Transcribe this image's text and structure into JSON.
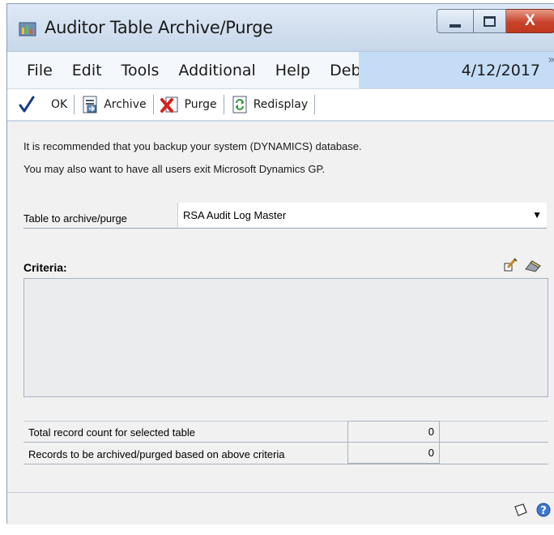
{
  "window": {
    "title": "Auditor Table Archive/Purge",
    "close_label": "X"
  },
  "menu": {
    "items": [
      "File",
      "Edit",
      "Tools",
      "Additional",
      "Help",
      "Debug"
    ],
    "date": "4/12/2017",
    "overflow": "»"
  },
  "toolbar": {
    "ok_label": "OK",
    "archive_label": "Archive",
    "purge_label": "Purge",
    "redisplay_label": "Redisplay"
  },
  "notes": {
    "line1": "It is recommended that you backup your system (DYNAMICS) database.",
    "line2": "You may also want to have all users exit Microsoft Dynamics GP."
  },
  "table_select": {
    "label": "Table to archive/purge",
    "value": "RSA Audit Log Master"
  },
  "criteria": {
    "label": "Criteria:"
  },
  "counts": [
    {
      "label": "Total record count for selected table",
      "value": "0"
    },
    {
      "label": "Records to be archived/purged based on above criteria",
      "value": "0"
    }
  ],
  "colors": {
    "accent": "#c5dcf7",
    "close_button": "#c9432c",
    "checkmark": "#1b3a8a"
  },
  "icons": [
    "app-icon",
    "checkmark-icon",
    "archive-icon",
    "purge-icon",
    "redisplay-icon",
    "edit-criteria-icon",
    "clear-criteria-icon",
    "note-icon",
    "help-icon"
  ]
}
